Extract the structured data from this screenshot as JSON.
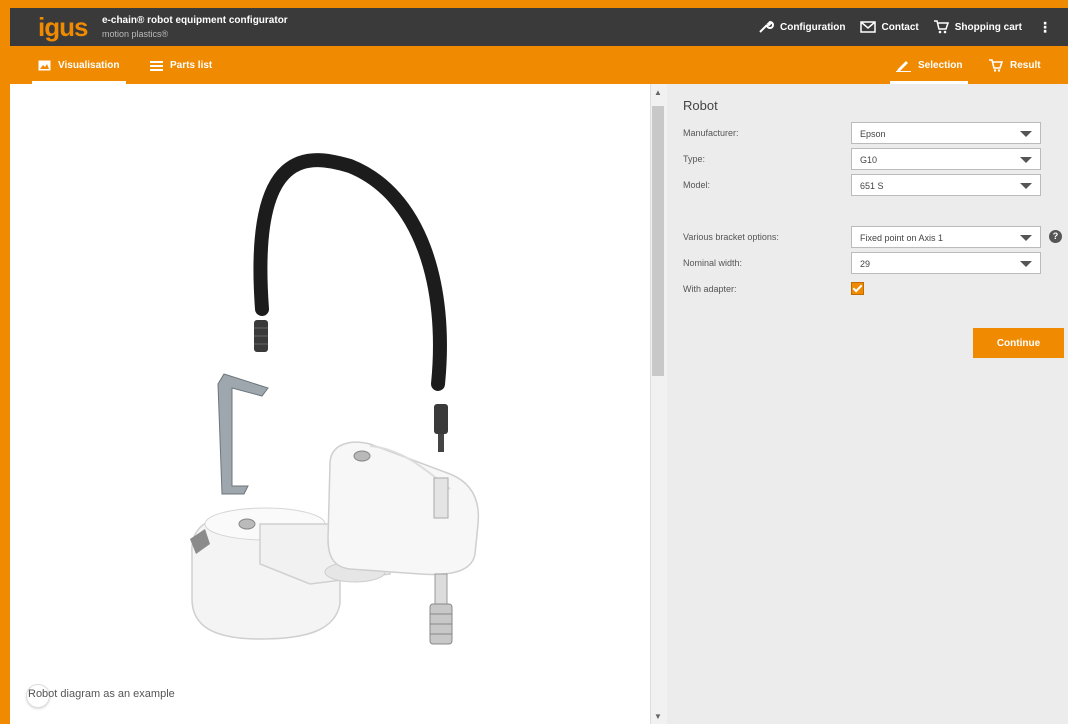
{
  "app": {
    "logo": "igus",
    "title": "e-chain® robot equipment configurator",
    "subtitle": "motion plastics®"
  },
  "topnav": {
    "configuration": "Configuration",
    "contact": "Contact",
    "cart": "Shopping cart",
    "more": "⋮"
  },
  "tabs": {
    "visualisation": "Visualisation",
    "parts_list": "Parts list",
    "selection": "Selection",
    "result": "Result"
  },
  "viz": {
    "caption": "Robot diagram as an example"
  },
  "form": {
    "title": "Robot",
    "manufacturer_label": "Manufacturer:",
    "manufacturer_value": "Epson",
    "type_label": "Type:",
    "type_value": "G10",
    "model_label": "Model:",
    "model_value": "651 S",
    "bracket_label": "Various bracket options:",
    "bracket_value": "Fixed point on Axis 1",
    "width_label": "Nominal width:",
    "width_value": "29",
    "adapter_label": "With adapter:",
    "adapter_checked": true,
    "continue_label": "Continue"
  },
  "colors": {
    "accent": "#f08a00",
    "topbar": "#3a3a3a",
    "panel": "#ececec"
  }
}
